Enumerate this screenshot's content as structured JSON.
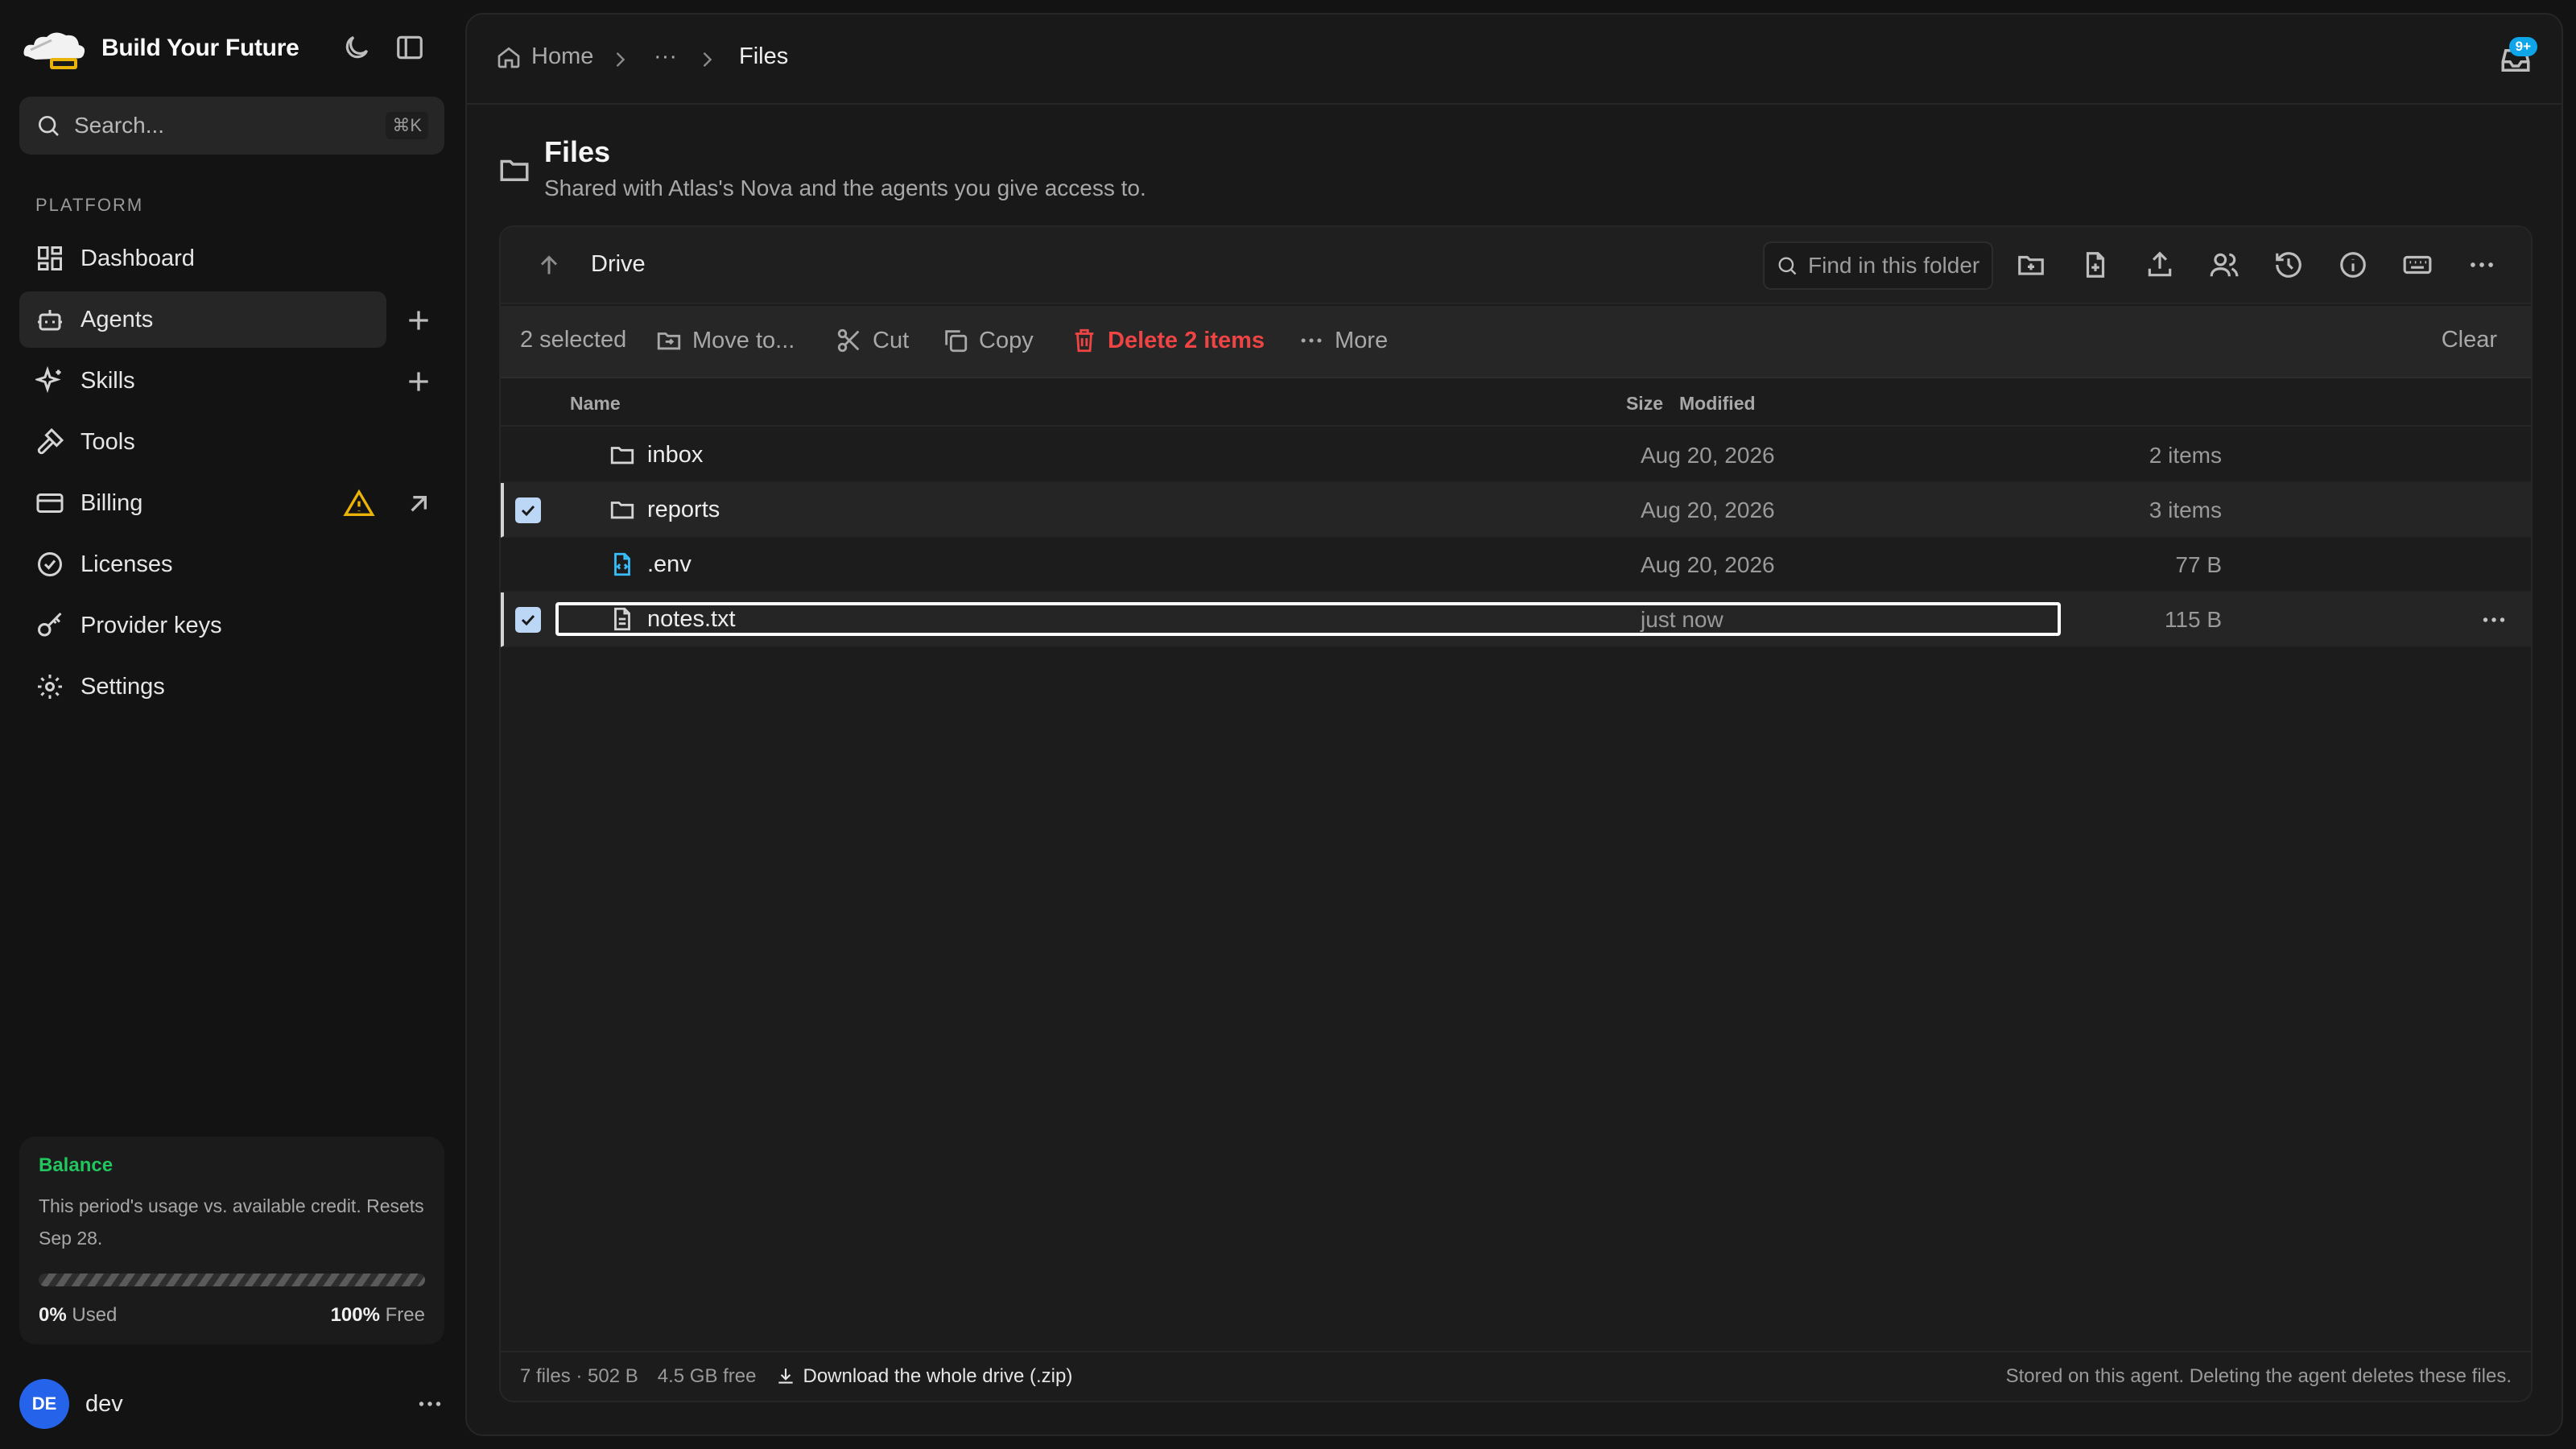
{
  "app": {
    "name": "Build Your Future"
  },
  "search": {
    "placeholder": "Search...",
    "shortcut": "⌘K"
  },
  "sidebar": {
    "section": "PLATFORM",
    "items": [
      {
        "label": "Dashboard",
        "icon": "dashboard-icon"
      },
      {
        "label": "Agents",
        "icon": "bot-icon",
        "active": true
      },
      {
        "label": "Skills",
        "icon": "sparkles-icon"
      },
      {
        "label": "Tools",
        "icon": "hammer-icon"
      },
      {
        "label": "Billing",
        "icon": "card-icon",
        "warning": true
      },
      {
        "label": "Licenses",
        "icon": "badge-check-icon"
      },
      {
        "label": "Provider keys",
        "icon": "key-icon"
      },
      {
        "label": "Settings",
        "icon": "gear-icon"
      }
    ]
  },
  "balance": {
    "title": "Balance",
    "description": "This period's usage vs. available credit. Resets Sep 28.",
    "used_value": "0%",
    "used_label": "Used",
    "free_value": "100%",
    "free_label": "Free",
    "used_fraction": 0
  },
  "user": {
    "initials": "DE",
    "name": "dev"
  },
  "breadcrumb": {
    "home": "Home",
    "ellipsis": "···",
    "current": "Files"
  },
  "notifications": {
    "badge": "9+"
  },
  "page": {
    "title": "Files",
    "subtitle": "Shared with Atlas's Nova and the agents you give access to."
  },
  "toolbar": {
    "title": "Drive",
    "find_placeholder": "Find in this folder"
  },
  "selection": {
    "count": "2 selected",
    "move": "Move to...",
    "cut": "Cut",
    "copy": "Copy",
    "delete": "Delete 2 items",
    "more": "More",
    "clear": "Clear"
  },
  "table": {
    "headers": {
      "name": "Name",
      "size": "Size",
      "modified": "Modified"
    },
    "rows": [
      {
        "name": "inbox",
        "type": "folder",
        "size": "2 items",
        "modified": "Aug 20, 2026",
        "selected": false
      },
      {
        "name": "reports",
        "type": "folder",
        "size": "3 items",
        "modified": "Aug 20, 2026",
        "selected": true
      },
      {
        "name": ".env",
        "type": "code-file",
        "size": "77 B",
        "modified": "Aug 20, 2026",
        "selected": false
      },
      {
        "name": "notes.txt",
        "type": "text-file",
        "size": "115 B",
        "modified": "just now",
        "selected": true
      }
    ]
  },
  "footer": {
    "summary": "7 files · 502 B",
    "free": "4.5 GB free",
    "download": "Download the whole drive (.zip)",
    "note": "Stored on this agent. Deleting the agent deletes these files."
  },
  "colors": {
    "accent": "#22c55e",
    "danger": "#ef4444",
    "badge": "#0ea5e9",
    "avatar": "#2563eb"
  }
}
